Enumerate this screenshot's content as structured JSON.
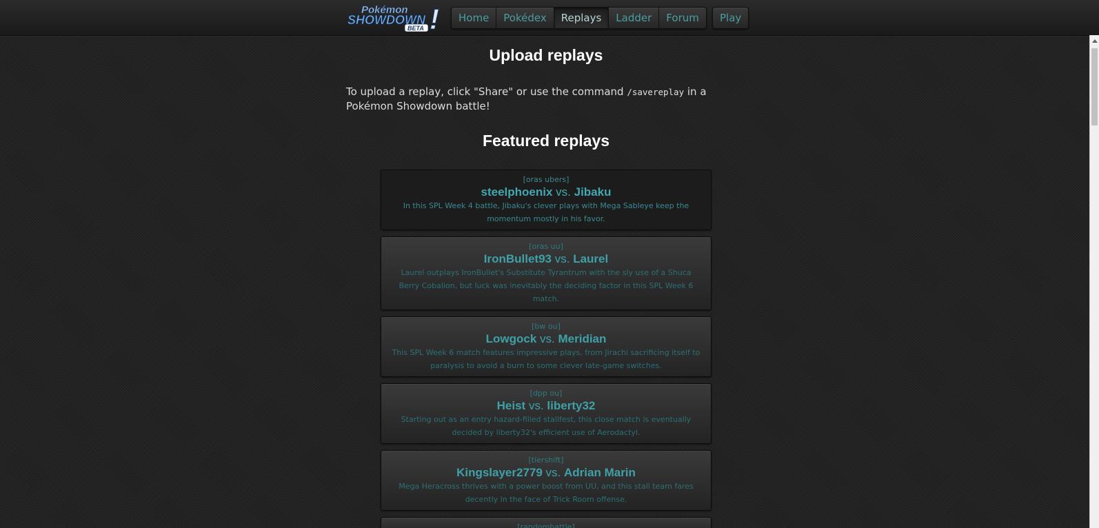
{
  "header": {
    "logo": {
      "line1": "Pokémon",
      "line2": "SHOWDOWN",
      "badge": "BETA",
      "mark": "!"
    },
    "nav": [
      {
        "label": "Home",
        "active": false
      },
      {
        "label": "Pokédex",
        "active": false
      },
      {
        "label": "Replays",
        "active": true
      },
      {
        "label": "Ladder",
        "active": false
      },
      {
        "label": "Forum",
        "active": false
      }
    ],
    "play_label": "Play"
  },
  "upload": {
    "title": "Upload replays",
    "text_before": "To upload a replay, click \"Share\" or use the command ",
    "command": "/savereplay",
    "text_after": " in a Pokémon Showdown battle!"
  },
  "featured": {
    "title": "Featured replays",
    "replays": [
      {
        "format": "[oras ubers]",
        "p1": "steelphoenix",
        "vs": "vs.",
        "p2": "Jibaku",
        "desc": "In this SPL Week 4 battle, Jibaku's clever plays with Mega Sableye keep the momentum mostly in his favor."
      },
      {
        "format": "[oras uu]",
        "p1": "IronBullet93",
        "vs": "vs.",
        "p2": "Laurel",
        "desc": "Laurel outplays IronBullet's Substitute Tyrantrum with the sly use of a Shuca Berry Cobalion, but luck was inevitably the deciding factor in this SPL Week 6 match."
      },
      {
        "format": "[bw ou]",
        "p1": "Lowgock",
        "vs": "vs.",
        "p2": "Meridian",
        "desc": "This SPL Week 6 match features impressive plays, from Jirachi sacrificing itself to paralysis to avoid a burn to some clever late-game switches."
      },
      {
        "format": "[dpp ou]",
        "p1": "Heist",
        "vs": "vs.",
        "p2": "liberty32",
        "desc": "Starting out as an entry hazard-filled stallfest, this close match is eventually decided by liberty32's efficient use of Aerodactyl."
      },
      {
        "format": "[tiershift]",
        "p1": "Kingslayer2779",
        "vs": "vs.",
        "p2": "Adrian Marin",
        "desc": "Mega Heracross thrives with a power boost from UU, and this stall team fares decently in the face of Trick Room offense."
      },
      {
        "format": "[randombattle]",
        "p1": "",
        "vs": "",
        "p2": "",
        "desc": ""
      }
    ]
  },
  "colors": {
    "accent": "#3fa0a8",
    "background": "#232323",
    "title": "#ffffff"
  }
}
